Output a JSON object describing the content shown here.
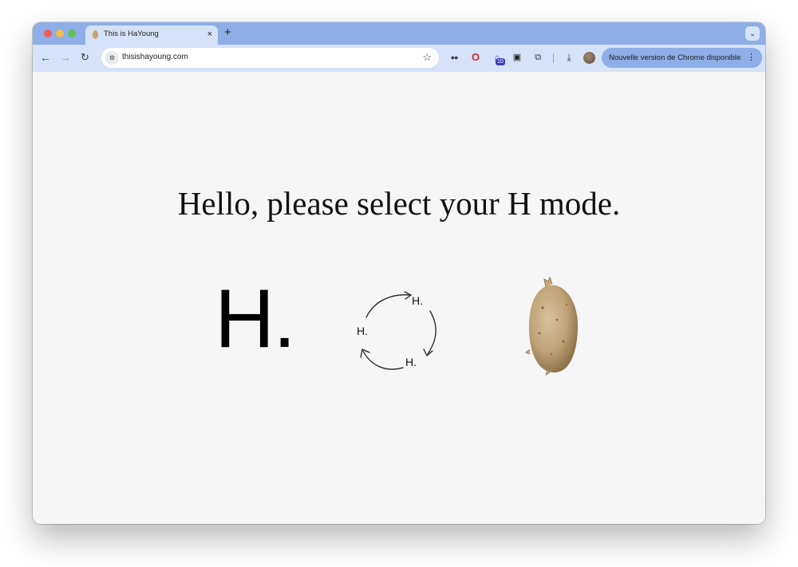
{
  "browser": {
    "tab": {
      "title": "This is HaYoung",
      "close_icon": "×"
    },
    "new_tab_icon": "+",
    "tab_search_icon": "⌄",
    "address_bar": {
      "url": "thisishayoung.com"
    },
    "extensions": {
      "badge_count": "10"
    },
    "update_button": {
      "label": "Nouvelle version de Chrome disponible",
      "menu_icon": "⋮"
    },
    "colors": {
      "tabstrip": "#8daee6",
      "toolbar": "#d5e2f8"
    }
  },
  "page": {
    "headline": "Hello, please select your H mode.",
    "modes": [
      {
        "label": "H."
      },
      {
        "labels": [
          "H.",
          "H.",
          "H."
        ],
        "icon": "cycle-arrows-icon"
      },
      {
        "icon": "potato-icon"
      }
    ],
    "background": "#f6f6f6"
  }
}
